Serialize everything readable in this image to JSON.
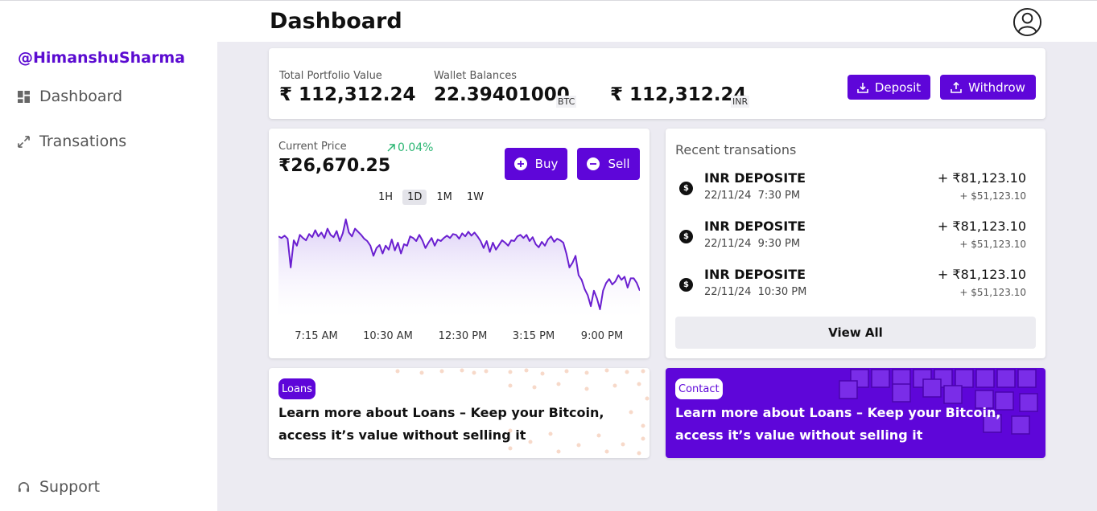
{
  "sidebar": {
    "brand": "@HimanshuSharma",
    "items": [
      {
        "label": "Dashboard",
        "icon": "dashboard-icon"
      },
      {
        "label": "Transations",
        "icon": "transactions-icon"
      }
    ],
    "support": {
      "label": "Support",
      "icon": "headset-icon"
    }
  },
  "header": {
    "title": "Dashboard",
    "avatar_icon": "user-circle-icon"
  },
  "portfolio": {
    "total_label": "Total Portfolio Value",
    "total_value": "₹ 112,312.24",
    "wallet_label": "Wallet Balances",
    "btc_value": "22.39401000",
    "btc_unit": "BTC",
    "inr_value": "₹ 112,312.24",
    "inr_unit": "INR",
    "deposit_label": "Deposit",
    "withdraw_label": "Withdrow"
  },
  "price": {
    "label": "Current Price",
    "value": "₹26,670.25",
    "change": "0.04%",
    "buy_label": "Buy",
    "sell_label": "Sell",
    "timeframes": [
      "1H",
      "1D",
      "1M",
      "1W"
    ],
    "active_timeframe": "1D"
  },
  "chart_data": {
    "type": "area",
    "x_labels": [
      "7:15 AM",
      "10:30 AM",
      "12:30 PM",
      "3:15 PM",
      "9:00 PM"
    ],
    "values": [
      50,
      48,
      51,
      47,
      10,
      45,
      38,
      52,
      48,
      45,
      53,
      49,
      58,
      50,
      55,
      48,
      60,
      52,
      49,
      57,
      44,
      54,
      72,
      55,
      50,
      60,
      56,
      52,
      47,
      44,
      38,
      25,
      35,
      39,
      28,
      38,
      33,
      46,
      32,
      42,
      28,
      40,
      38,
      50,
      48,
      44,
      52,
      45,
      35,
      42,
      48,
      38,
      46,
      44,
      48,
      51,
      48,
      53,
      52,
      47,
      54,
      50,
      56,
      51,
      55,
      50,
      44,
      35,
      44,
      30,
      42,
      33,
      39,
      45,
      42,
      38,
      45,
      44,
      50,
      52,
      48,
      52,
      44,
      49,
      40,
      36,
      43,
      38,
      46,
      50,
      43,
      47,
      45,
      42,
      28,
      10,
      16,
      25,
      0,
      -6,
      -18,
      -26,
      -40,
      -20,
      -30,
      -44,
      -20,
      -10,
      -5,
      -12,
      -8,
      0,
      -6,
      -2,
      -16,
      -4,
      -4,
      -10,
      -20
    ]
  },
  "recent": {
    "title": "Recent transations",
    "transactions": [
      {
        "name": "INR DEPOSITE",
        "date": "22/11/24",
        "time": "7:30 PM",
        "amount": "+ ₹81,123.10",
        "usd": "+ $51,123.10"
      },
      {
        "name": "INR DEPOSITE",
        "date": "22/11/24",
        "time": "9:30 PM",
        "amount": "+ ₹81,123.10",
        "usd": "+ $51,123.10"
      },
      {
        "name": "INR DEPOSITE",
        "date": "22/11/24",
        "time": "10:30 PM",
        "amount": "+ ₹81,123.10",
        "usd": "+ $51,123.10"
      }
    ],
    "view_all_label": "View All"
  },
  "promos": {
    "loans": {
      "tag": "Loans",
      "text": "Learn more about Loans – Keep your Bitcoin, access it’s value without selling it"
    },
    "contact": {
      "tag": "Contact",
      "text": "Learn more about Loans – Keep your Bitcoin, access it’s value without selling it"
    }
  },
  "colors": {
    "accent": "#5e06d9",
    "positive": "#2bb673",
    "line": "#6a1fd0"
  }
}
